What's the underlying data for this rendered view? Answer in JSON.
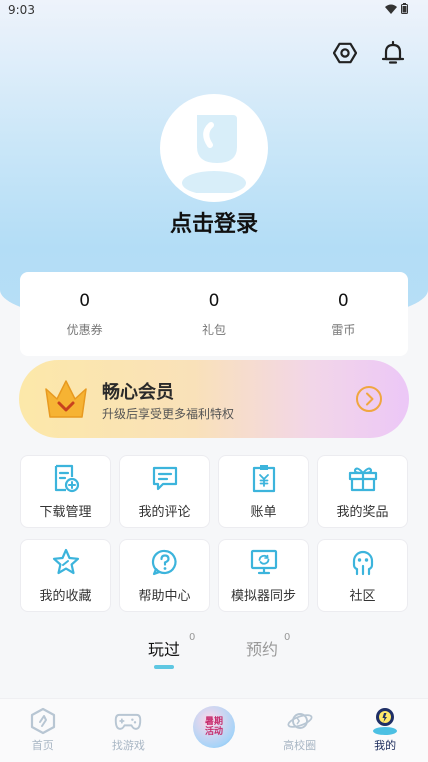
{
  "status_bar": {
    "time": "9:03"
  },
  "profile": {
    "login_prompt": "点击登录"
  },
  "stats": [
    {
      "value": "0",
      "label": "优惠券"
    },
    {
      "value": "0",
      "label": "礼包"
    },
    {
      "value": "0",
      "label": "雷币"
    }
  ],
  "vip": {
    "title": "畅心会员",
    "subtitle": "升级后享受更多福利特权"
  },
  "menu": [
    {
      "label": "下载管理",
      "icon": "download-manage-icon"
    },
    {
      "label": "我的评论",
      "icon": "comment-icon"
    },
    {
      "label": "账单",
      "icon": "bill-icon"
    },
    {
      "label": "我的奖品",
      "icon": "gift-icon"
    },
    {
      "label": "我的收藏",
      "icon": "star-icon"
    },
    {
      "label": "帮助中心",
      "icon": "help-icon"
    },
    {
      "label": "模拟器同步",
      "icon": "emulator-sync-icon"
    },
    {
      "label": "社区",
      "icon": "community-icon"
    }
  ],
  "tabs": [
    {
      "label": "玩过",
      "count": "0",
      "active": true
    },
    {
      "label": "预约",
      "count": "0",
      "active": false
    }
  ],
  "bottom_nav": [
    {
      "label": "首页",
      "icon": "home-icon"
    },
    {
      "label": "找游戏",
      "icon": "gamepad-icon"
    },
    {
      "label": "",
      "icon": "event-badge-icon",
      "badge_text": [
        "暑期",
        "活动"
      ]
    },
    {
      "label": "高校圈",
      "icon": "planet-icon"
    },
    {
      "label": "我的",
      "icon": "profile-icon",
      "active": true
    }
  ],
  "colors": {
    "accent": "#5ec7e2",
    "icon_blue": "#3cb4dc",
    "vip_orange": "#f0a640"
  }
}
